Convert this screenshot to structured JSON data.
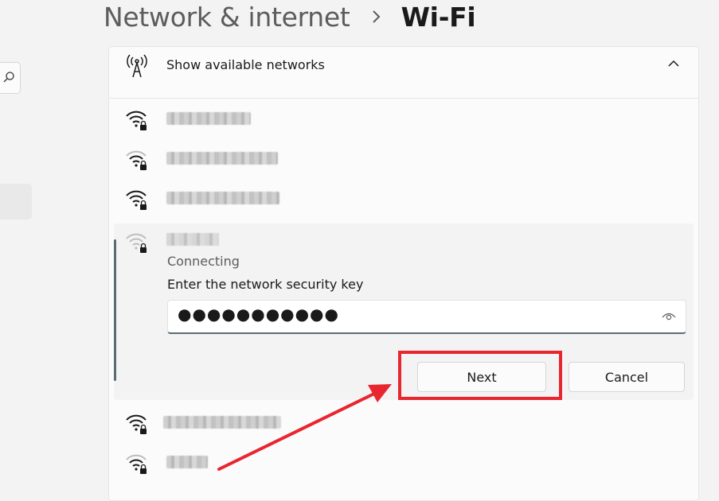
{
  "breadcrumb": {
    "parent": "Network & internet",
    "current": "Wi-Fi"
  },
  "panel": {
    "title": "Show available networks",
    "antenna_icon": "antenna-icon",
    "collapse_icon": "chevron-up-icon"
  },
  "networks": [
    {
      "blurred": true,
      "signal": "full",
      "secured": true
    },
    {
      "blurred": true,
      "signal": "medium",
      "secured": true
    },
    {
      "blurred": true,
      "signal": "full",
      "secured": true
    },
    {
      "blurred": true,
      "signal": "weak",
      "secured": true,
      "expanded": true
    },
    {
      "blurred": true,
      "signal": "full",
      "secured": true
    },
    {
      "blurred": true,
      "signal": "medium",
      "secured": true
    }
  ],
  "connecting": {
    "status": "Connecting",
    "prompt": "Enter the network security key",
    "password_mask": "●●●●●●●●●●●",
    "reveal_icon": "eye-icon",
    "next_label": "Next",
    "cancel_label": "Cancel"
  },
  "annotation": {
    "color": "#e8262f"
  },
  "colors": {
    "accent": "#5b6b73",
    "background": "#f3f3f3",
    "card": "#fbfbfb"
  }
}
